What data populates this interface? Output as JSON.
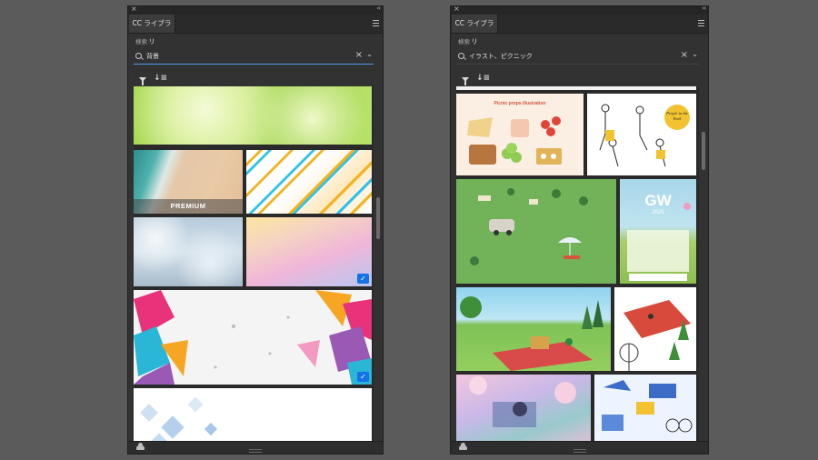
{
  "panels": [
    {
      "tab_label": "CC ライブラリ",
      "search_label": "検索",
      "search_value": "背景"
    },
    {
      "tab_label": "CC ライブラリ",
      "search_label": "検索",
      "search_value": "イラスト、ピクニック"
    }
  ],
  "icons": {
    "close": "×",
    "collapse": "‹‹",
    "clear": "×",
    "chevron": "⌄",
    "sort": "↓≡",
    "check": "✓"
  },
  "tiles": {
    "premium_label": "PREMIUM",
    "picnic_title": "Picnic props illustration",
    "people_text": "People in the Park",
    "gw_text": "GW",
    "gw_year": "2025"
  },
  "colors": {
    "accent": "#1473e6",
    "search_underline": "#4e9af0",
    "panel_bg": "#323232"
  }
}
